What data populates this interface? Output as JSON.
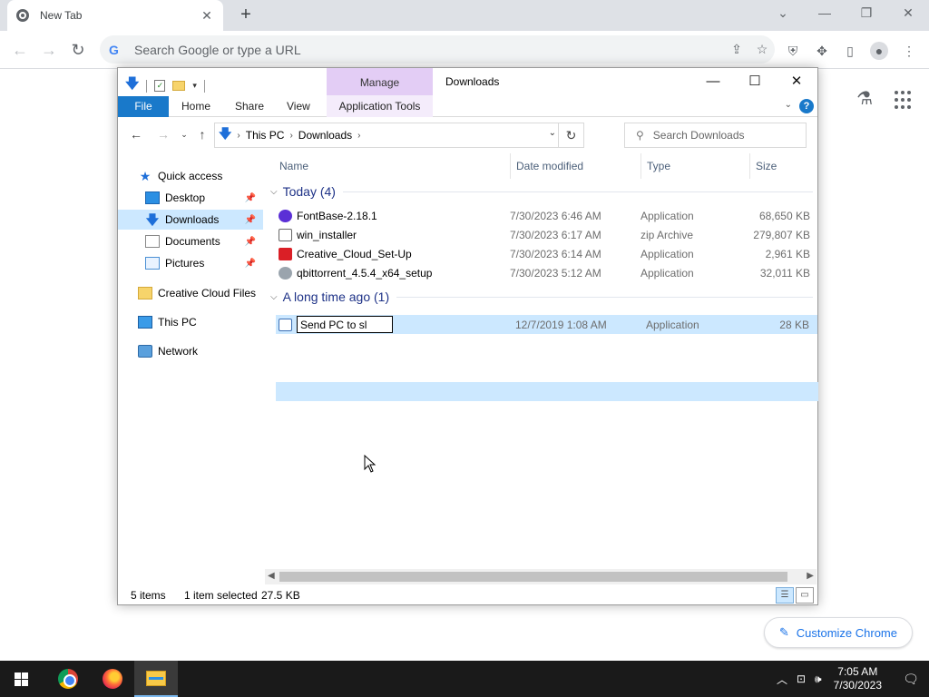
{
  "chrome": {
    "tab_title": "New Tab",
    "tab_close": "✕",
    "new_tab": "+",
    "omnibox_placeholder": "Search Google or type a URL",
    "customize_label": "Customize Chrome"
  },
  "explorer": {
    "window_title": "Downloads",
    "manage_tab": "Manage",
    "ribbon": {
      "file": "File",
      "home": "Home",
      "share": "Share",
      "view": "View",
      "app_tools": "Application Tools"
    },
    "address": {
      "crumbs": [
        "This PC",
        "Downloads"
      ]
    },
    "search_placeholder": "Search Downloads",
    "nav": {
      "quick_access": "Quick access",
      "desktop": "Desktop",
      "downloads": "Downloads",
      "documents": "Documents",
      "pictures": "Pictures",
      "creative_cloud": "Creative Cloud Files",
      "this_pc": "This PC",
      "network": "Network"
    },
    "columns": {
      "name": "Name",
      "date": "Date modified",
      "type": "Type",
      "size": "Size"
    },
    "groups": {
      "today": "Today (4)",
      "long_ago": "A long time ago (1)"
    },
    "files": [
      {
        "name": "FontBase-2.18.1",
        "date": "7/30/2023 6:46 AM",
        "type": "Application",
        "size": "68,650 KB",
        "icon_color": "#5b2fd6"
      },
      {
        "name": "win_installer",
        "date": "7/30/2023 6:17 AM",
        "type": "zip Archive",
        "size": "279,807 KB",
        "icon_color": "#f1c232"
      },
      {
        "name": "Creative_Cloud_Set-Up",
        "date": "7/30/2023 6:14 AM",
        "type": "Application",
        "size": "2,961 KB",
        "icon_color": "#da1f26"
      },
      {
        "name": "qbittorrent_4.5.4_x64_setup",
        "date": "7/30/2023 5:12 AM",
        "type": "Application",
        "size": "32,011 KB",
        "icon_color": "#9aa4ad"
      }
    ],
    "old_file": {
      "rename_value": "Send PC to sl",
      "date": "12/7/2019 1:08 AM",
      "type": "Application",
      "size": "28 KB"
    },
    "status": {
      "items": "5 items",
      "selected": "1 item selected",
      "size": "27.5 KB"
    }
  },
  "taskbar": {
    "time": "7:05 AM",
    "date": "7/30/2023"
  },
  "colors": {
    "accent": "#1979ca",
    "selection": "#cce8ff",
    "manage": "#e3cdf5"
  }
}
